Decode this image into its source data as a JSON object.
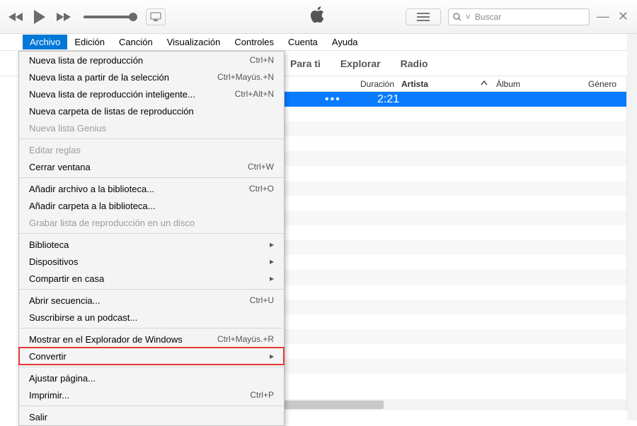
{
  "search": {
    "placeholder": "Buscar"
  },
  "menubar": {
    "items": [
      "Archivo",
      "Edición",
      "Canción",
      "Visualización",
      "Controles",
      "Cuenta",
      "Ayuda"
    ],
    "active_index": 0
  },
  "tabs": [
    "Para ti",
    "Explorar",
    "Radio"
  ],
  "columns": {
    "duracion": "Duración",
    "artista": "Artista",
    "album": "Álbum",
    "genero": "Género"
  },
  "selected_row": {
    "more": "•••",
    "duration": "2:21"
  },
  "dropdown": {
    "items": [
      {
        "label": "Nueva lista de reproducción",
        "shortcut": "Ctrl+N"
      },
      {
        "label": "Nueva lista a partir de la selección",
        "shortcut": "Ctrl+Mayús.+N"
      },
      {
        "label": "Nueva lista de reproducción inteligente...",
        "shortcut": "Ctrl+Alt+N"
      },
      {
        "label": "Nueva carpeta de listas de reproducción",
        "shortcut": ""
      },
      {
        "label": "Nueva lista Genius",
        "shortcut": "",
        "disabled": true
      },
      {
        "sep": true
      },
      {
        "label": "Editar reglas",
        "shortcut": "",
        "disabled": true
      },
      {
        "label": "Cerrar ventana",
        "shortcut": "Ctrl+W"
      },
      {
        "sep": true
      },
      {
        "label": "Añadir archivo a la biblioteca...",
        "shortcut": "Ctrl+O"
      },
      {
        "label": "Añadir carpeta a la biblioteca...",
        "shortcut": ""
      },
      {
        "label": "Grabar lista de reproducción en un disco",
        "shortcut": "",
        "disabled": true
      },
      {
        "sep": true
      },
      {
        "label": "Biblioteca",
        "submenu": true
      },
      {
        "label": "Dispositivos",
        "submenu": true
      },
      {
        "label": "Compartir en casa",
        "submenu": true
      },
      {
        "sep": true
      },
      {
        "label": "Abrir secuencia...",
        "shortcut": "Ctrl+U"
      },
      {
        "label": "Suscribirse a un podcast...",
        "shortcut": ""
      },
      {
        "sep": true
      },
      {
        "label": "Mostrar en el Explorador de Windows",
        "shortcut": "Ctrl+Mayús.+R"
      },
      {
        "label": "Convertir",
        "submenu": true,
        "highlight": true
      },
      {
        "sep": true
      },
      {
        "label": "Ajustar página...",
        "shortcut": ""
      },
      {
        "label": "Imprimir...",
        "shortcut": "Ctrl+P"
      },
      {
        "sep": true
      },
      {
        "label": "Salir",
        "shortcut": ""
      }
    ]
  }
}
